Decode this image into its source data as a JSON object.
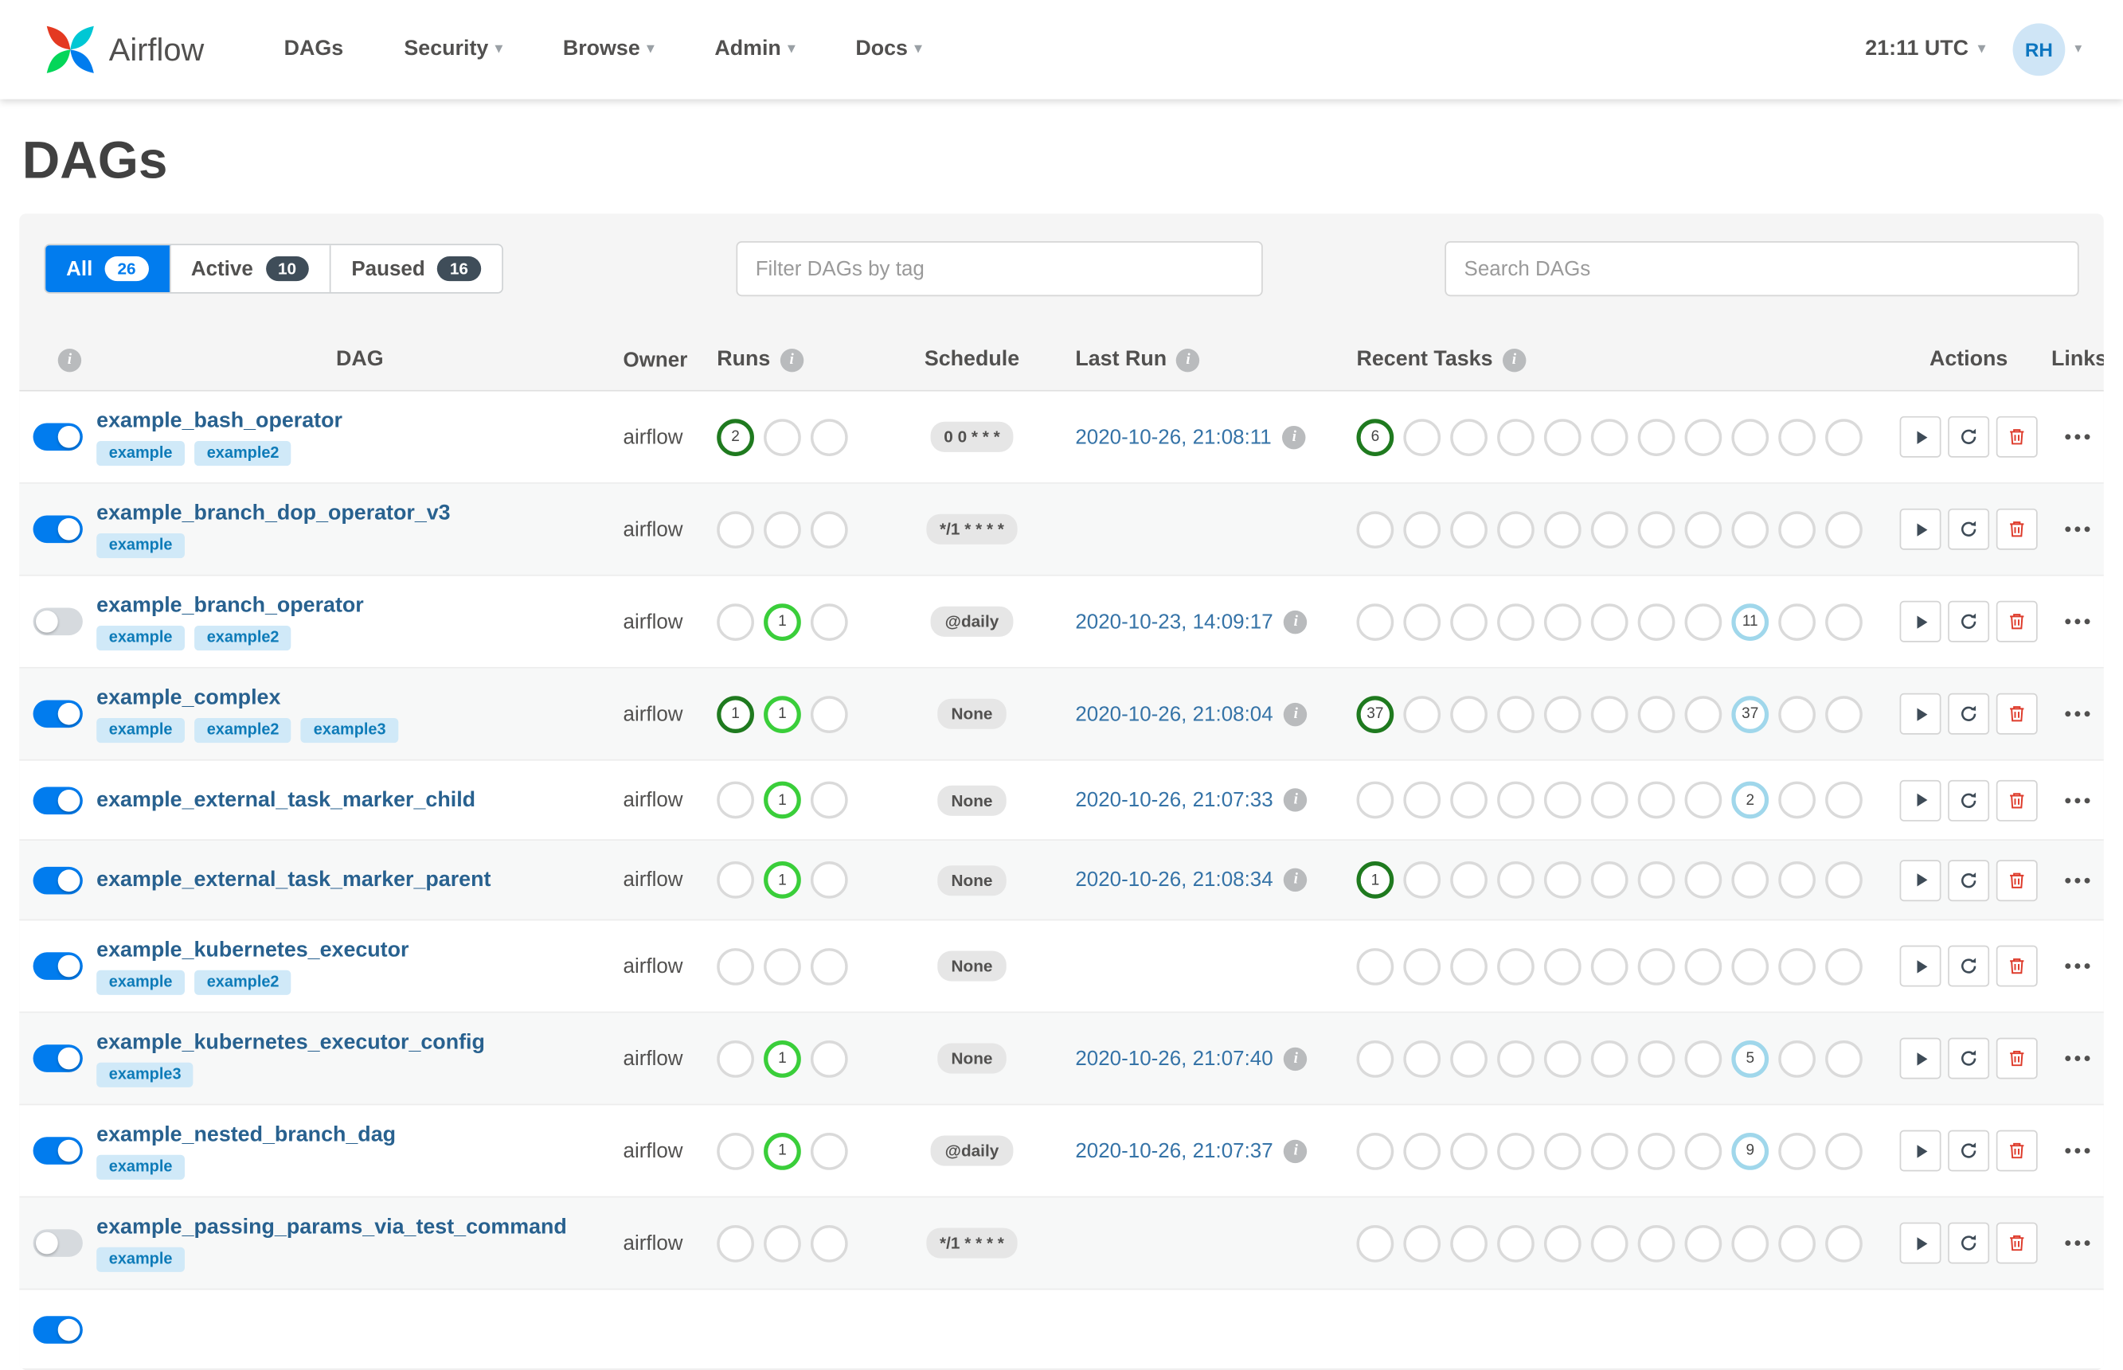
{
  "navbar": {
    "brand": "Airflow",
    "items": [
      {
        "label": "DAGs",
        "caret": false
      },
      {
        "label": "Security",
        "caret": true
      },
      {
        "label": "Browse",
        "caret": true
      },
      {
        "label": "Admin",
        "caret": true
      },
      {
        "label": "Docs",
        "caret": true
      }
    ],
    "clock": "21:11 UTC",
    "avatar_initials": "RH"
  },
  "page": {
    "title": "DAGs"
  },
  "filters": {
    "tabs": [
      {
        "label": "All",
        "count": 26,
        "active": true
      },
      {
        "label": "Active",
        "count": 10,
        "active": false
      },
      {
        "label": "Paused",
        "count": 16,
        "active": false
      }
    ],
    "tag_filter_placeholder": "Filter DAGs by tag",
    "search_placeholder": "Search DAGs"
  },
  "table": {
    "columns": [
      "DAG",
      "Owner",
      "Runs",
      "Schedule",
      "Last Run",
      "Recent Tasks",
      "Actions",
      "Links"
    ],
    "runs_slots": 3,
    "recent_slots": 11,
    "rows": [
      {
        "name": "example_bash_operator",
        "enabled": true,
        "tags": [
          "example",
          "example2"
        ],
        "owner": "airflow",
        "runs": [
          {
            "slot": 0,
            "count": 2,
            "state": "success"
          }
        ],
        "schedule": "0 0 * * *",
        "last_run": "2020-10-26, 21:08:11",
        "recent": [
          {
            "slot": 0,
            "count": 6,
            "state": "success"
          }
        ]
      },
      {
        "name": "example_branch_dop_operator_v3",
        "enabled": true,
        "tags": [
          "example"
        ],
        "owner": "airflow",
        "runs": [],
        "schedule": "*/1 * * * *",
        "last_run": "",
        "recent": []
      },
      {
        "name": "example_branch_operator",
        "enabled": false,
        "tags": [
          "example",
          "example2"
        ],
        "owner": "airflow",
        "runs": [
          {
            "slot": 1,
            "count": 1,
            "state": "running"
          }
        ],
        "schedule": "@daily",
        "last_run": "2020-10-23, 14:09:17",
        "recent": [
          {
            "slot": 8,
            "count": 11,
            "state": "none"
          }
        ]
      },
      {
        "name": "example_complex",
        "enabled": true,
        "tags": [
          "example",
          "example2",
          "example3"
        ],
        "owner": "airflow",
        "runs": [
          {
            "slot": 0,
            "count": 1,
            "state": "success"
          },
          {
            "slot": 1,
            "count": 1,
            "state": "running"
          }
        ],
        "schedule": "None",
        "last_run": "2020-10-26, 21:08:04",
        "recent": [
          {
            "slot": 0,
            "count": 37,
            "state": "success"
          },
          {
            "slot": 8,
            "count": 37,
            "state": "none"
          }
        ]
      },
      {
        "name": "example_external_task_marker_child",
        "enabled": true,
        "tags": [],
        "owner": "airflow",
        "runs": [
          {
            "slot": 1,
            "count": 1,
            "state": "running"
          }
        ],
        "schedule": "None",
        "last_run": "2020-10-26, 21:07:33",
        "recent": [
          {
            "slot": 8,
            "count": 2,
            "state": "none"
          }
        ]
      },
      {
        "name": "example_external_task_marker_parent",
        "enabled": true,
        "tags": [],
        "owner": "airflow",
        "runs": [
          {
            "slot": 1,
            "count": 1,
            "state": "running"
          }
        ],
        "schedule": "None",
        "last_run": "2020-10-26, 21:08:34",
        "recent": [
          {
            "slot": 0,
            "count": 1,
            "state": "success"
          }
        ]
      },
      {
        "name": "example_kubernetes_executor",
        "enabled": true,
        "tags": [
          "example",
          "example2"
        ],
        "owner": "airflow",
        "runs": [],
        "schedule": "None",
        "last_run": "",
        "recent": []
      },
      {
        "name": "example_kubernetes_executor_config",
        "enabled": true,
        "tags": [
          "example3"
        ],
        "owner": "airflow",
        "runs": [
          {
            "slot": 1,
            "count": 1,
            "state": "running"
          }
        ],
        "schedule": "None",
        "last_run": "2020-10-26, 21:07:40",
        "recent": [
          {
            "slot": 8,
            "count": 5,
            "state": "none"
          }
        ]
      },
      {
        "name": "example_nested_branch_dag",
        "enabled": true,
        "tags": [
          "example"
        ],
        "owner": "airflow",
        "runs": [
          {
            "slot": 1,
            "count": 1,
            "state": "running"
          }
        ],
        "schedule": "@daily",
        "last_run": "2020-10-26, 21:07:37",
        "recent": [
          {
            "slot": 8,
            "count": 9,
            "state": "none"
          }
        ]
      },
      {
        "name": "example_passing_params_via_test_command",
        "enabled": false,
        "tags": [
          "example"
        ],
        "owner": "airflow",
        "runs": [],
        "schedule": "*/1 * * * *",
        "last_run": "",
        "recent": []
      },
      {
        "partial": true,
        "enabled": true,
        "tags": [],
        "owner": "",
        "runs": [],
        "schedule": "",
        "last_run": "",
        "recent": []
      }
    ]
  },
  "colors": {
    "accent": "#017cee",
    "dag_link": "#28618f",
    "lastrun_link": "#3573a7",
    "success": "#1f7a1f",
    "running": "#3ace3a",
    "no_status": "#a0d7eb",
    "tag_bg": "#d0e9f8",
    "tag_text": "#0e7bb8",
    "danger": "#de3b2b",
    "tab_badge_dark": "#3f4d59",
    "text": "#51504f"
  }
}
